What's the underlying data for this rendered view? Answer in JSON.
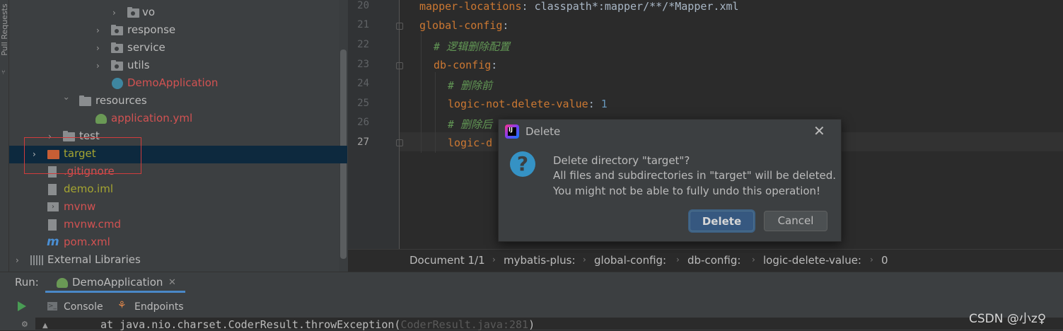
{
  "sidebar": {
    "pull_requests_label": "Pull Requests"
  },
  "project_tree": {
    "vo": "vo",
    "response": "response",
    "service": "service",
    "utils": "utils",
    "demo_application": "DemoApplication",
    "resources": "resources",
    "application_yml": "application.yml",
    "test": "test",
    "target": "target",
    "gitignore": ".gitignore",
    "demo_iml": "demo.iml",
    "mvnw": "mvnw",
    "mvnw_cmd": "mvnw.cmd",
    "pom_xml": "pom.xml",
    "external_libraries": "External Libraries"
  },
  "editor": {
    "line_numbers": [
      "20",
      "21",
      "22",
      "23",
      "24",
      "25",
      "26",
      "27"
    ],
    "lines": {
      "l20_key": "mapper-locations",
      "l20_val": "classpath*:mapper/**/*Mapper.xml",
      "l21_key": "global-config",
      "l22_comment": "# 逻辑删除配置",
      "l23_key": "db-config",
      "l24_comment": "# 删除前",
      "l25_key": "logic-not-delete-value",
      "l25_val": "1",
      "l26_comment": "# 删除后",
      "l27_key": "logic-d"
    }
  },
  "breadcrumb": [
    "Document 1/1",
    "mybatis-plus:",
    "global-config:",
    "db-config:",
    "logic-delete-value:",
    "0"
  ],
  "dialog": {
    "title": "Delete",
    "message_line1": "Delete directory \"target\"?",
    "message_line2": "All files and subdirectories in \"target\" will be deleted.",
    "message_line3": "You might not be able to fully undo this operation!",
    "delete_button": "Delete",
    "cancel_button": "Cancel"
  },
  "run_panel": {
    "run_label": "Run:",
    "tab_label": "DemoApplication",
    "console_label": "Console",
    "endpoints_label": "Endpoints",
    "console_line_prefix": "at java.nio.charset.CoderResult.throwException(",
    "console_line_link": "CoderResult.java:281",
    "console_line_suffix": ")"
  },
  "watermark": "CSDN @小z♀",
  "colors": {
    "accent": "#365880",
    "selection": "#0d293e",
    "keyword": "#cc7832",
    "comment": "#629755",
    "error_file": "#d25252",
    "modified_file": "#a5a531"
  }
}
